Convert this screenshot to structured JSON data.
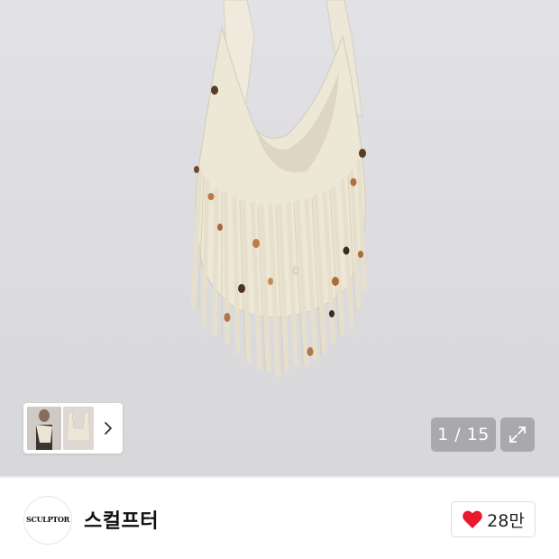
{
  "gallery": {
    "counter_current": "1",
    "counter_separator": " / ",
    "counter_total": "15",
    "expand_icon": "expand-icon",
    "next_icon": "chevron-right-icon"
  },
  "shop": {
    "logo_text": "SCULPTOR",
    "name": "스컬프터"
  },
  "like": {
    "icon": "heart-icon",
    "count": "28만",
    "color": "#e8192c"
  }
}
